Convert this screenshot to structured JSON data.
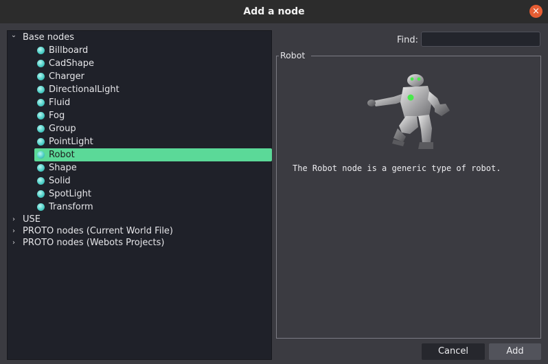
{
  "window": {
    "title": "Add a node",
    "close_symbol": "×"
  },
  "tree": {
    "base_nodes": {
      "label": "Base nodes",
      "expanded": true,
      "items": [
        {
          "label": "Billboard"
        },
        {
          "label": "CadShape"
        },
        {
          "label": "Charger"
        },
        {
          "label": "DirectionalLight"
        },
        {
          "label": "Fluid"
        },
        {
          "label": "Fog"
        },
        {
          "label": "Group"
        },
        {
          "label": "PointLight"
        },
        {
          "label": "Robot",
          "selected": true
        },
        {
          "label": "Shape"
        },
        {
          "label": "Solid"
        },
        {
          "label": "SpotLight"
        },
        {
          "label": "Transform"
        }
      ]
    },
    "collapsed_groups": [
      {
        "label": "USE"
      },
      {
        "label": "PROTO nodes (Current World File)"
      },
      {
        "label": "PROTO nodes (Webots Projects)"
      }
    ],
    "expanded_arrow": "⌄",
    "collapsed_arrow": "›"
  },
  "find": {
    "label": "Find:",
    "value": ""
  },
  "preview": {
    "group_title": "Robot",
    "image": "robot-preview",
    "description": "The Robot node is a generic type of robot."
  },
  "buttons": {
    "cancel": "Cancel",
    "add": "Add"
  },
  "colors": {
    "selection": "#5bd998",
    "close": "#e65d33",
    "tree_bg": "#1f2129",
    "panel_bg": "#3b3b41"
  }
}
